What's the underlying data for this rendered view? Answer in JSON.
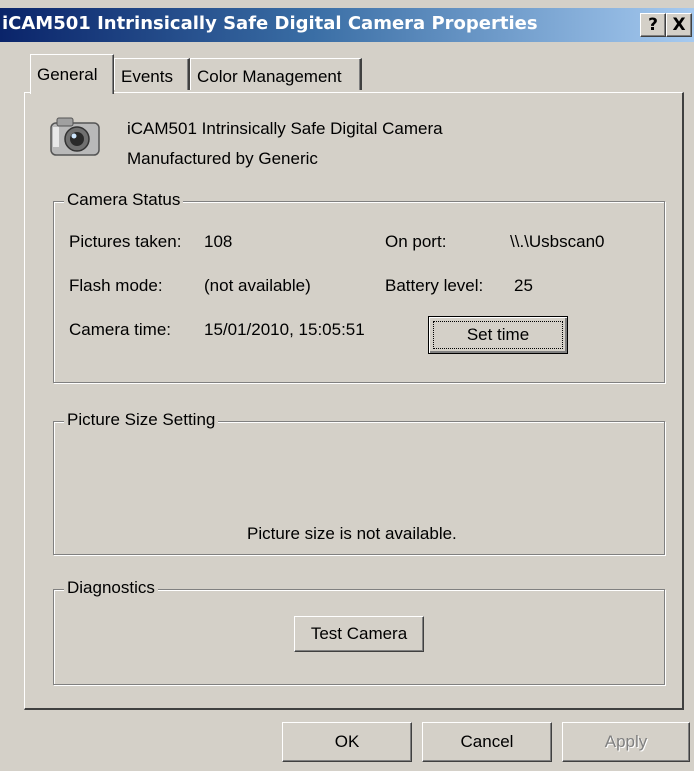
{
  "window": {
    "title": "iCAM501 Intrinsically Safe Digital Camera Properties",
    "help_button": "?",
    "close_button": "X"
  },
  "tabs": [
    {
      "label": "General",
      "active": true
    },
    {
      "label": "Events",
      "active": false
    },
    {
      "label": "Color Management",
      "active": false
    }
  ],
  "device": {
    "icon": "camera-icon",
    "name": "iCAM501 Intrinsically Safe Digital Camera",
    "manufacturer": "Manufactured by  Generic"
  },
  "camera_status": {
    "legend": "Camera Status",
    "pictures_taken_label": "Pictures taken:",
    "pictures_taken_value": "108",
    "on_port_label": "On port:",
    "on_port_value": "\\\\.\\Usbscan0",
    "flash_mode_label": "Flash mode:",
    "flash_mode_value": "(not available)",
    "battery_label": "Battery level:",
    "battery_value": "25",
    "camera_time_label": "Camera time:",
    "camera_time_value": "15/01/2010, 15:05:51",
    "set_time_button": "Set time"
  },
  "picture_size": {
    "legend": "Picture Size Setting",
    "message": "Picture size is not available."
  },
  "diagnostics": {
    "legend": "Diagnostics",
    "test_button": "Test Camera"
  },
  "footer": {
    "ok": "OK",
    "cancel": "Cancel",
    "apply": "Apply"
  },
  "colors": {
    "title_gradient_start": "#0a246a",
    "title_gradient_end": "#a6caf0",
    "face": "#d4d0c8"
  }
}
